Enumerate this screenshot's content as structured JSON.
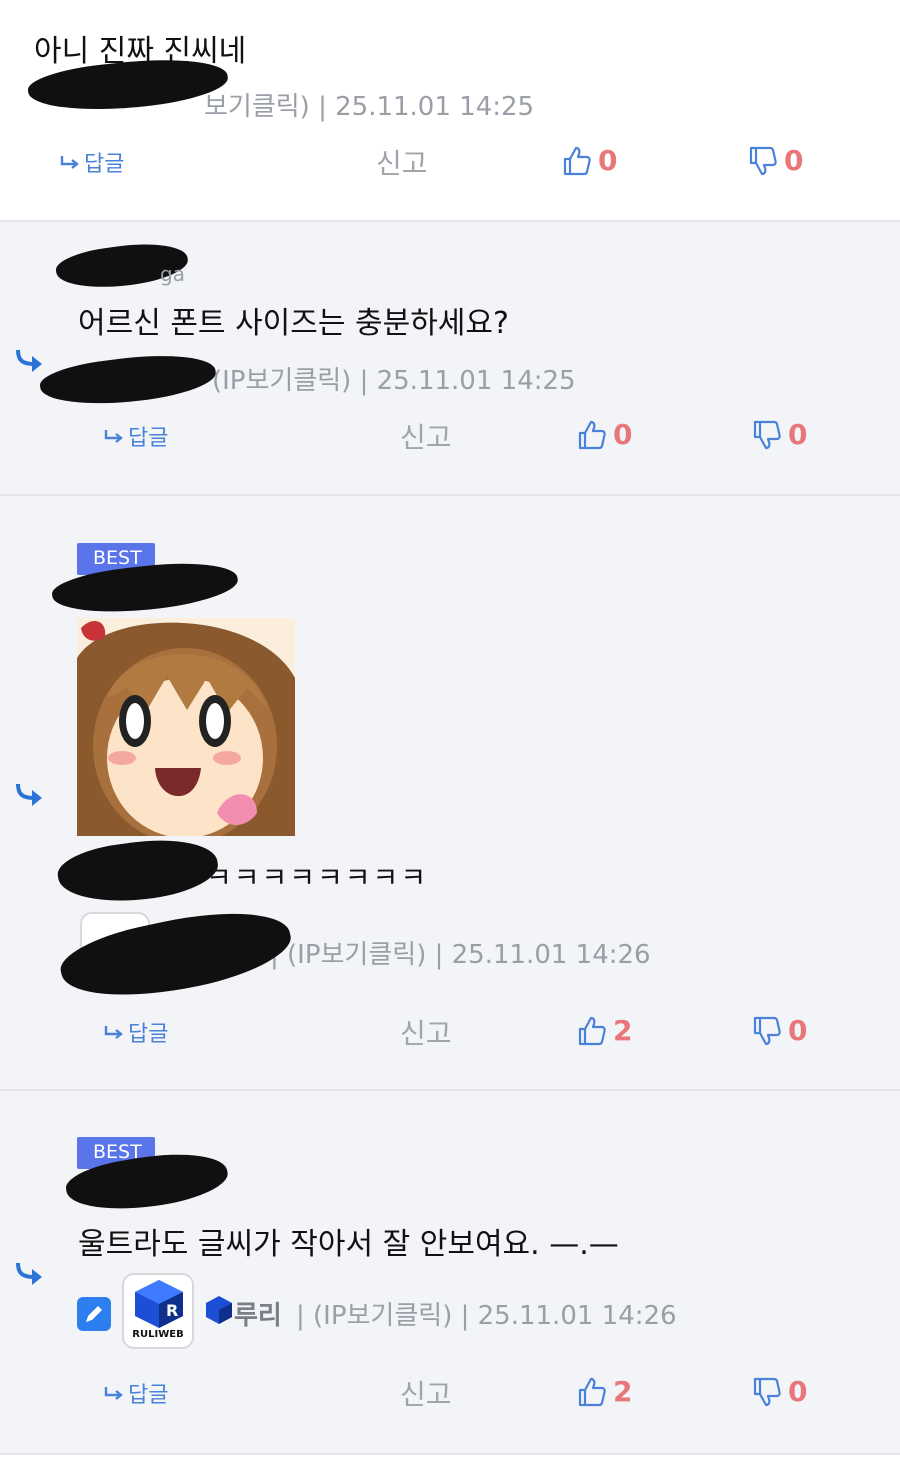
{
  "comments": [
    {
      "text": "아니 진짜 진씨네",
      "meta_tail": "보기클릭) | 25.11.01 14:25",
      "reply_label": "답글",
      "report_label": "신고",
      "up_count": "0",
      "down_count": "0"
    },
    {
      "nick_fragment": "ga",
      "text": "어르신 폰트 사이즈는 충분하세요?",
      "meta_tail": "(IP보기클릭) | 25.11.01 14:25",
      "reply_label": "답글",
      "report_label": "신고",
      "up_count": "0",
      "down_count": "0"
    },
    {
      "badge": "BEST",
      "text": "ㅋㅋㅋㅋㅋㅋㅋㅋ",
      "meta_tail": "| (IP보기클릭) | 25.11.01 14:26",
      "reply_label": "답글",
      "report_label": "신고",
      "up_count": "2",
      "down_count": "0"
    },
    {
      "badge": "BEST",
      "text": "울트라도 글씨가 작아서 잘 안보여요. —.—",
      "author": "루리",
      "avatar_label": "RULIWEB",
      "meta_tail": "| (IP보기클릭) | 25.11.01 14:26",
      "reply_label": "답글",
      "report_label": "신고",
      "up_count": "2",
      "down_count": "0"
    }
  ],
  "colors": {
    "accent_blue": "#4a82d9",
    "vote_red": "#e8767a",
    "best_badge": "#5a74ea",
    "reply_bg": "#f2f4f7"
  },
  "icons": [
    "reply-arrow-icon",
    "thumbs-up-icon",
    "thumbs-down-icon",
    "edit-icon",
    "ruliweb-logo"
  ]
}
